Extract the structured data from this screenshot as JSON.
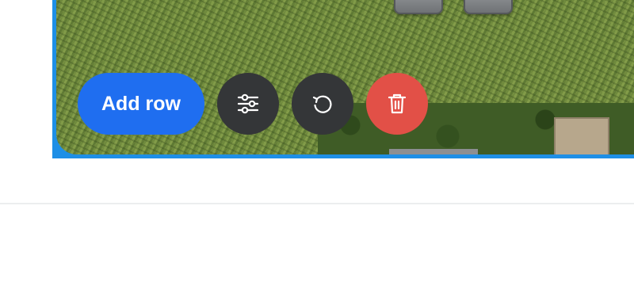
{
  "toolbar": {
    "add_row_label": "Add row",
    "settings_icon": "sliders-icon",
    "reset_icon": "rotate-ccw-icon",
    "delete_icon": "trash-icon"
  },
  "colors": {
    "primary": "#1f6ef0",
    "dark_button": "#343638",
    "danger": "#e25047",
    "frame_border": "#1e8fe6"
  }
}
